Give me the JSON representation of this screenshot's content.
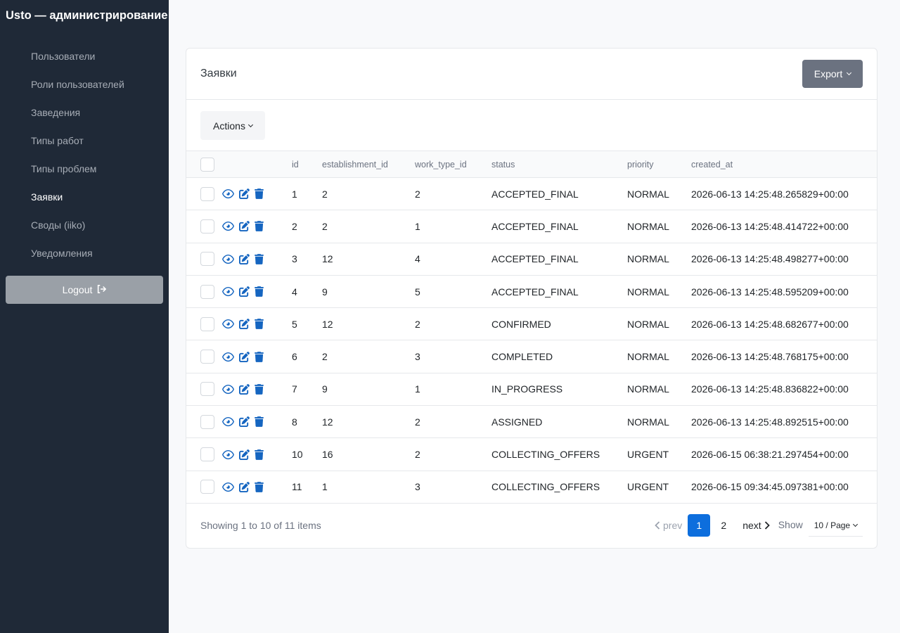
{
  "sidebar": {
    "brand": "Usto — администрирование",
    "items": [
      {
        "label": "Пользователи"
      },
      {
        "label": "Роли пользователей"
      },
      {
        "label": "Заведения"
      },
      {
        "label": "Типы работ"
      },
      {
        "label": "Типы проблем"
      },
      {
        "label": "Заявки"
      },
      {
        "label": "Своды (iiko)"
      },
      {
        "label": "Уведомления"
      }
    ],
    "active_index": 5,
    "logout_label": "Logout"
  },
  "card": {
    "title": "Заявки",
    "export_label": "Export",
    "actions_label": "Actions"
  },
  "table": {
    "columns": [
      "id",
      "establishment_id",
      "work_type_id",
      "status",
      "priority",
      "created_at"
    ],
    "rows": [
      {
        "id": "1",
        "establishment_id": "2",
        "work_type_id": "2",
        "status": "ACCEPTED_FINAL",
        "priority": "NORMAL",
        "created_at": "2026-06-13 14:25:48.265829+00:00"
      },
      {
        "id": "2",
        "establishment_id": "2",
        "work_type_id": "1",
        "status": "ACCEPTED_FINAL",
        "priority": "NORMAL",
        "created_at": "2026-06-13 14:25:48.414722+00:00"
      },
      {
        "id": "3",
        "establishment_id": "12",
        "work_type_id": "4",
        "status": "ACCEPTED_FINAL",
        "priority": "NORMAL",
        "created_at": "2026-06-13 14:25:48.498277+00:00"
      },
      {
        "id": "4",
        "establishment_id": "9",
        "work_type_id": "5",
        "status": "ACCEPTED_FINAL",
        "priority": "NORMAL",
        "created_at": "2026-06-13 14:25:48.595209+00:00"
      },
      {
        "id": "5",
        "establishment_id": "12",
        "work_type_id": "2",
        "status": "CONFIRMED",
        "priority": "NORMAL",
        "created_at": "2026-06-13 14:25:48.682677+00:00"
      },
      {
        "id": "6",
        "establishment_id": "2",
        "work_type_id": "3",
        "status": "COMPLETED",
        "priority": "NORMAL",
        "created_at": "2026-06-13 14:25:48.768175+00:00"
      },
      {
        "id": "7",
        "establishment_id": "9",
        "work_type_id": "1",
        "status": "IN_PROGRESS",
        "priority": "NORMAL",
        "created_at": "2026-06-13 14:25:48.836822+00:00"
      },
      {
        "id": "8",
        "establishment_id": "12",
        "work_type_id": "2",
        "status": "ASSIGNED",
        "priority": "NORMAL",
        "created_at": "2026-06-13 14:25:48.892515+00:00"
      },
      {
        "id": "10",
        "establishment_id": "16",
        "work_type_id": "2",
        "status": "COLLECTING_OFFERS",
        "priority": "URGENT",
        "created_at": "2026-06-15 06:38:21.297454+00:00"
      },
      {
        "id": "11",
        "establishment_id": "1",
        "work_type_id": "3",
        "status": "COLLECTING_OFFERS",
        "priority": "URGENT",
        "created_at": "2026-06-15 09:34:45.097381+00:00"
      }
    ],
    "row_icons": [
      "eye-icon",
      "edit-icon",
      "trash-icon"
    ]
  },
  "footer": {
    "showing": "Showing 1 to 10 of 11 items",
    "prev": "prev",
    "next": "next",
    "pages": [
      "1",
      "2"
    ],
    "current_page": "1",
    "show_label": "Show",
    "page_size": "10 / Page"
  },
  "colors": {
    "sidebar_bg": "#1f2937",
    "accent": "#0d6edd",
    "icon_blue": "#1565c0",
    "export_bg": "#6b7280"
  }
}
